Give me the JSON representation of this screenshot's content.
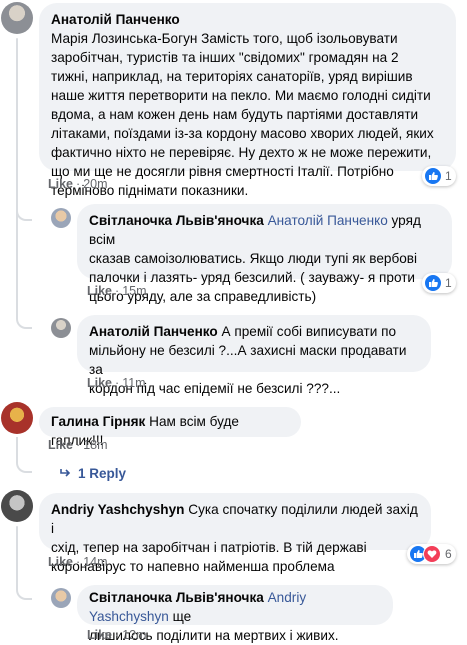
{
  "comments": [
    {
      "author": "Анатолій Панченко",
      "lines": [
        "Марія Лозинська-Богун Замість того, щоб ізольовувати",
        "заробітчан, туристів та інших \"свідомих\" громадян на 2",
        "тижні, наприклад, на територіях санаторіїв, уряд вирішив",
        "наше життя перетворити на пекло. Ми маємо голодні сидіти",
        "вдома, а нам кожен день нам будуть партіями доставляти",
        "літаками, поїздами із-за кордону масово хворих людей, яких",
        "фактично ніхто не перевіряє. Ну дехто ж не може пережити,",
        "що ми ще не досягли рівня смертності Італії. Потрібно",
        "терміново піднімати показники."
      ],
      "like": "Like",
      "time": "20m",
      "reaction_count": "1"
    },
    {
      "author": "Світланочка Львів'яночка",
      "tag": "Анатолій Панченко",
      "first_text": " уряд всім",
      "lines": [
        "сказав самоізолюватись. Якщо люди тупі як вербові",
        "палочки і лазять- уряд безсилий. ( зауважу- я проти",
        "цього уряду, але за справедливість)"
      ],
      "like": "Like",
      "time": "15m",
      "reaction_count": "1"
    },
    {
      "author": "Анатолій Панченко",
      "first_text": " А премії собі виписувати по",
      "lines": [
        "мільйону не безсилі ?...А захисні маски продавати за",
        "кордон під час епідемії не безсилі ???..."
      ],
      "like": "Like",
      "time": "11m"
    },
    {
      "author": "Галина Гірняк",
      "first_text": " Нам всім буде гаплик!!!",
      "like": "Like",
      "time": "18m",
      "reply_link": "1 Reply"
    },
    {
      "author": "Andriy Yashchyshyn",
      "first_text": " Сука спочатку поділили людей захід і",
      "lines": [
        "схід, тепер на заробітчан і патріотів. В тій державі",
        "коронавірус то напевно найменша проблема"
      ],
      "like": "Like",
      "time": "14m",
      "reaction_count": "6"
    },
    {
      "author": "Світланочка Львів'яночка",
      "tag": "Andriy Yashchyshyn",
      "first_text": " ще",
      "lines": [
        "лишилось поділити на мертвих і живих."
      ],
      "like": "Like",
      "time": "12m"
    }
  ],
  "colors": {
    "bubble": "#f0f2f5",
    "link": "#385898",
    "meta": "#65676b",
    "like_blue": "#1877f2",
    "heart_red": "#f33e58"
  },
  "icons": [
    "thumbs-up-icon",
    "heart-icon",
    "reply-arrow-icon"
  ]
}
